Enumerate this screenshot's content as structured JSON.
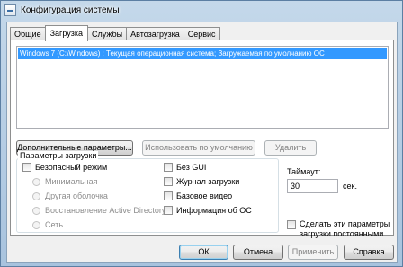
{
  "window": {
    "title": "Конфигурация системы"
  },
  "tabs": [
    {
      "label": "Общие"
    },
    {
      "label": "Загрузка",
      "active": true
    },
    {
      "label": "Службы"
    },
    {
      "label": "Автозагрузка"
    },
    {
      "label": "Сервис"
    }
  ],
  "os_list": {
    "items": [
      {
        "text": "Windows 7 (C:\\Windows) : Текущая операционная система; Загружаемая по умолчанию ОС",
        "selected": true
      }
    ]
  },
  "list_buttons": {
    "advanced": "Дополнительные параметры...",
    "set_default": "Использовать по умолчанию",
    "delete": "Удалить"
  },
  "boot_options": {
    "title": "Параметры загрузки",
    "safe_boot": "Безопасный режим",
    "minimal": "Минимальная",
    "alternate_shell": "Другая оболочка",
    "ad_repair": "Восстановление Active Directory",
    "network": "Сеть",
    "no_gui": "Без GUI",
    "boot_log": "Журнал загрузки",
    "base_video": "Базовое видео",
    "os_info": "Информация  об ОС"
  },
  "timeout": {
    "label": "Таймаут:",
    "value": "30",
    "unit": "сек."
  },
  "permanent": {
    "line1": "Сделать эти параметры",
    "line2": "загрузки постоянными"
  },
  "dialog_buttons": {
    "ok": "ОК",
    "cancel": "Отмена",
    "apply": "Применить",
    "help": "Справка"
  },
  "colors": {
    "selection": "#3399ff",
    "accent": "#3c7fb1"
  }
}
